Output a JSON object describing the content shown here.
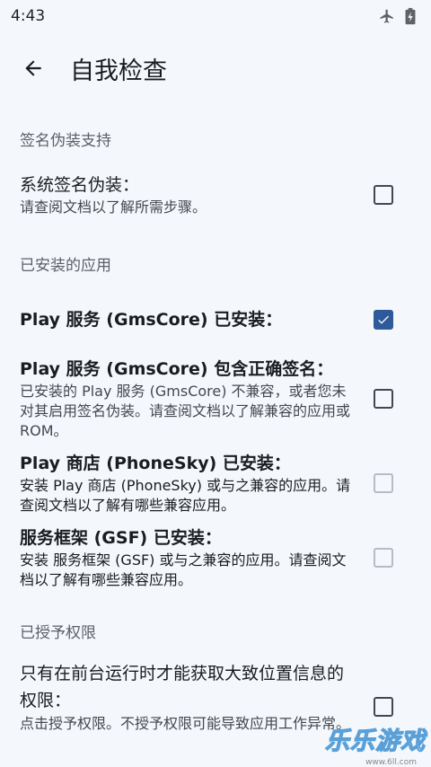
{
  "status": {
    "time": "4:43"
  },
  "header": {
    "title": "自我检查"
  },
  "sections": {
    "signature": "签名伪装支持",
    "installed": "已安装的应用",
    "permissions": "已授予权限"
  },
  "items": {
    "sig_spoof": {
      "title": "系统签名伪装：",
      "desc": "请查阅文档以了解所需步骤。",
      "checked": false
    },
    "gms_installed": {
      "title": "Play 服务 (GmsCore) 已安装：",
      "checked": true
    },
    "gms_signature": {
      "title": "Play 服务 (GmsCore) 包含正确签名：",
      "desc": "已安装的 Play 服务 (GmsCore) 不兼容，或者您未对其启用签名伪装。请查阅文档以了解兼容的应用或 ROM。",
      "checked": false
    },
    "phonesky": {
      "title": "Play 商店 (PhoneSky) 已安装：",
      "desc": "安装 Play 商店 (PhoneSky) 或与之兼容的应用。请查阅文档以了解有哪些兼容应用。",
      "checked": false
    },
    "gsf": {
      "title": "服务框架 (GSF) 已安装：",
      "desc": "安装 服务框架 (GSF) 或与之兼容的应用。请查阅文档以了解有哪些兼容应用。",
      "checked": false
    },
    "location": {
      "title": "只有在前台运行时才能获取大致位置信息的权限：",
      "desc": "点击授予权限。不授予权限可能导致应用工作异常。",
      "checked": false
    }
  },
  "watermark": {
    "text": "乐乐游戏",
    "url": "www.6ll.com"
  },
  "colors": {
    "accent": "#2f5a9a",
    "background": "#f4f8fc"
  }
}
